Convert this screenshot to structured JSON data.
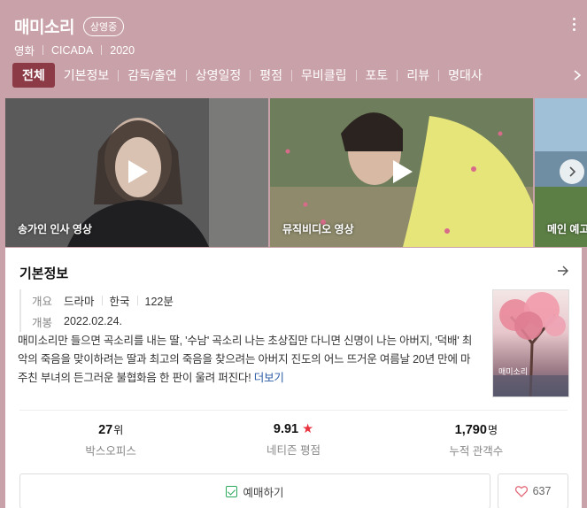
{
  "header": {
    "title": "매미소리",
    "status_badge": "상영중",
    "meta": [
      "영화",
      "CICADA",
      "2020"
    ]
  },
  "tabs": [
    "전체",
    "기본정보",
    "감독/출연",
    "상영일정",
    "평점",
    "무비클립",
    "포토",
    "리뷰",
    "명대사"
  ],
  "videos": [
    {
      "label": "송가인 인사 영상"
    },
    {
      "label": "뮤직비디오 영상"
    },
    {
      "label": "메인 예고"
    }
  ],
  "basic_info": {
    "heading": "기본정보",
    "overview_key": "개요",
    "genre": "드라마",
    "country": "한국",
    "runtime": "122분",
    "release_key": "개봉",
    "release_date": "2022.02.24.",
    "description": "매미소리만 들으면 곡소리를 내는 딸, '수남' 곡소리 나는 초상집만 다니면 신명이 나는 아버지, '덕배' 최악의 죽음을 맞이하려는 딸과 최고의 죽음을 찾으려는 아버지 진도의 어느 뜨거운 여름날 20년 만에 마주친 부녀의 든그러운 불협화음 한 판이 울려 퍼진다! ",
    "more_link": "더보기",
    "poster_text": "매미소리"
  },
  "stats": [
    {
      "value": "27",
      "unit": "위",
      "label": "박스오피스"
    },
    {
      "value": "9.91",
      "unit": "",
      "label": "네티즌 평점"
    },
    {
      "value": "1,790",
      "unit": "명",
      "label": "누적 관객수"
    }
  ],
  "actions": {
    "book_label": "예매하기",
    "like_count": "637"
  },
  "colors": {
    "header_bg": "#c9a1a8",
    "active_tab": "#8b3a46",
    "star": "#e8333f",
    "link": "#2a5aa5",
    "check": "#2aa85b"
  }
}
